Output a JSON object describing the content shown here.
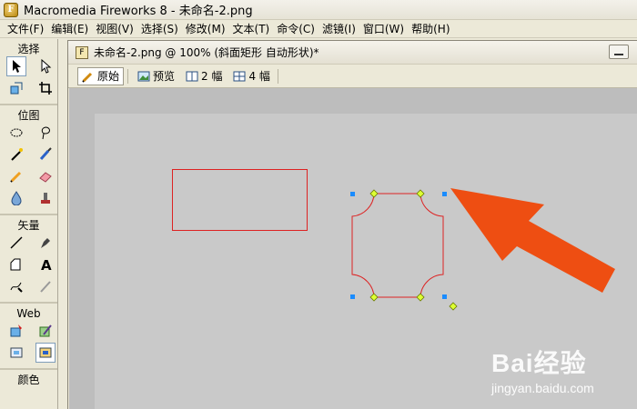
{
  "window": {
    "title": "Macromedia Fireworks 8 - 未命名-2.png",
    "logo_letter": "F"
  },
  "menubar": [
    {
      "label": "文件(F)"
    },
    {
      "label": "编辑(E)"
    },
    {
      "label": "视图(V)"
    },
    {
      "label": "选择(S)"
    },
    {
      "label": "修改(M)"
    },
    {
      "label": "文本(T)"
    },
    {
      "label": "命令(C)"
    },
    {
      "label": "滤镜(I)"
    },
    {
      "label": "窗口(W)"
    },
    {
      "label": "帮助(H)"
    }
  ],
  "tools_panel": {
    "sections": [
      {
        "label": "选择",
        "tools": [
          "pointer-tool-icon",
          "subselection-tool-icon",
          "scale-tool-icon",
          "crop-tool-icon"
        ]
      },
      {
        "label": "位图",
        "tools": [
          "marquee-tool-icon",
          "lasso-tool-icon",
          "magic-wand-tool-icon",
          "brush-tool-icon",
          "pencil-tool-icon",
          "eraser-tool-icon",
          "blur-tool-icon",
          "rubber-stamp-tool-icon"
        ]
      },
      {
        "label": "矢量",
        "tools": [
          "line-tool-icon",
          "pen-tool-icon",
          "rectangle-tool-icon",
          "text-tool-icon",
          "freeform-tool-icon",
          "knife-tool-icon"
        ]
      },
      {
        "label": "Web",
        "tools": [
          "hotspot-tool-icon",
          "slice-tool-icon",
          "hide-slices-icon",
          "show-slices-icon"
        ]
      },
      {
        "label": "颜色",
        "tools": []
      }
    ]
  },
  "document": {
    "title": "未命名-2.png @ 100% (斜面矩形 自动形状)*",
    "tabs": [
      {
        "label": "原始",
        "icon": "pencil-icon",
        "active": true
      },
      {
        "label": "预览",
        "icon": "image-preview-icon",
        "active": false
      },
      {
        "label": "2 幅",
        "icon": "two-up-icon",
        "active": false
      },
      {
        "label": "4 幅",
        "icon": "four-up-icon",
        "active": false
      }
    ]
  },
  "canvas": {
    "shapes": [
      "rectangle",
      "bevel-rectangle-auto-shape"
    ],
    "colors": {
      "stroke": "#dd2222",
      "handle": "#1a8cff",
      "control_point": "#ddff33",
      "arrow": "#ee4e12"
    }
  },
  "watermark": {
    "logo": "Bai经验",
    "url": "jingyan.baidu.com"
  },
  "colors": {
    "ui_bg": "#ece9d8",
    "canvas_bg": "#c9c9c9",
    "workspace_bg": "#bdbdbd"
  }
}
